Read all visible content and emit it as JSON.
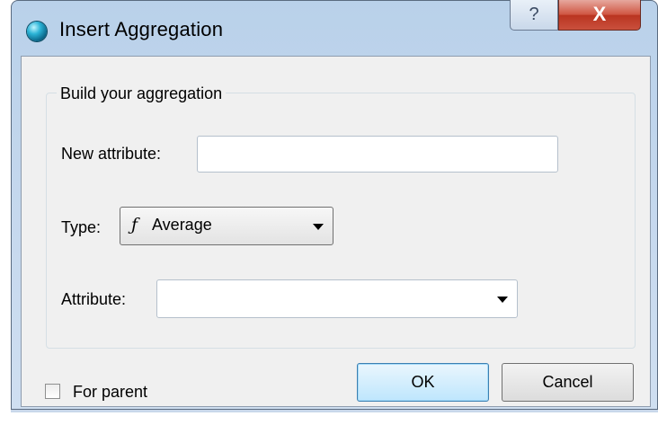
{
  "window": {
    "title": "Insert Aggregation",
    "help_label": "?",
    "close_label": "X"
  },
  "group": {
    "title": "Build your aggregation"
  },
  "fields": {
    "new_attribute_label": "New attribute:",
    "new_attribute_value": "",
    "type_label": "Type:",
    "type_icon": "function-icon",
    "type_symbol": "ƒ",
    "type_value": "Average",
    "attribute_label": "Attribute:",
    "attribute_value": ""
  },
  "footer": {
    "for_parent_label": "For parent",
    "for_parent_checked": false,
    "ok_label": "OK",
    "cancel_label": "Cancel"
  },
  "colors": {
    "close_button": "#c9503d",
    "ok_border": "#3c7fb1",
    "client_bg": "#f0f0f0"
  }
}
